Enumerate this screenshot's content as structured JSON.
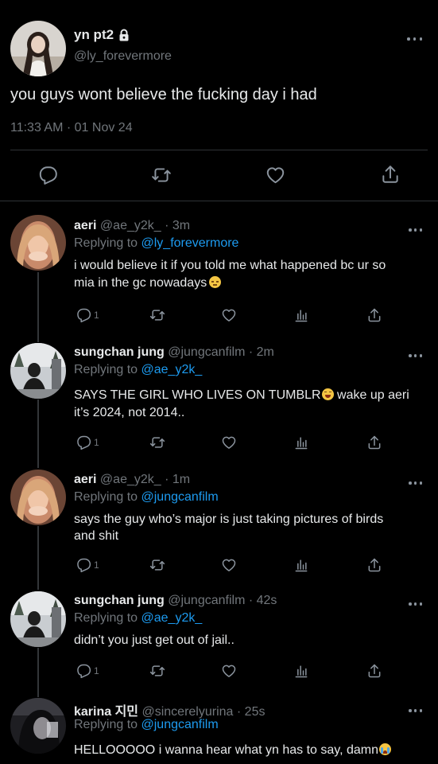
{
  "main_tweet": {
    "display_name": "yn pt2",
    "handle": "@ly_forevermore",
    "text": "you guys wont believe the fucking day i had",
    "time": "11:33 AM",
    "date": "01 Nov 24",
    "separator": "·"
  },
  "replies": [
    {
      "display_name": "aeri",
      "handle": "@ae_y2k_",
      "time": "· 3m",
      "replying_prefix": "Replying to",
      "replying_to": "@ly_forevermore",
      "text_line1": "i would believe it if you told me what happened bc ur so",
      "text_line2": "mia in the gc nowadays",
      "reply_count": "1"
    },
    {
      "display_name": "sungchan jung",
      "handle": "@jungcanfilm",
      "time": "· 2m",
      "replying_prefix": "Replying to",
      "replying_to": "@ae_y2k_",
      "text_line1": "SAYS THE GIRL WHO LIVES ON TUMBLR",
      "text_line1b": " wake up aeri",
      "text_line2": "it’s 2024, not 2014..",
      "reply_count": "1"
    },
    {
      "display_name": "aeri",
      "handle": "@ae_y2k_",
      "time": "· 1m",
      "replying_prefix": "Replying to",
      "replying_to": "@jungcanfilm",
      "text_line1": "says the guy who’s major is just taking pictures of birds",
      "text_line2": "and shit",
      "reply_count": "1"
    },
    {
      "display_name": "sungchan jung",
      "handle": "@jungcanfilm",
      "time": "· 42s",
      "replying_prefix": "Replying to",
      "replying_to": "@ae_y2k_",
      "text_line1": "didn’t you just get out of jail..",
      "reply_count": "1"
    },
    {
      "display_name": "karina 지민",
      "handle": "@sincerelyurina",
      "time": "· 25s",
      "replying_prefix": "Replying to",
      "replying_to": "@jungcanfilm",
      "text_line1": "HELLOOOOO i wanna hear what yn has to say, damn"
    }
  ],
  "icons": {
    "lock": "lock-icon",
    "more": "more-icon",
    "reply": "reply-icon",
    "retweet": "retweet-icon",
    "like": "like-icon",
    "views": "views-icon",
    "share": "share-icon"
  },
  "colors": {
    "background": "#000000",
    "text": "#e7e9ea",
    "muted": "#71767b",
    "link": "#1d9bf0",
    "divider": "#2f3336"
  }
}
